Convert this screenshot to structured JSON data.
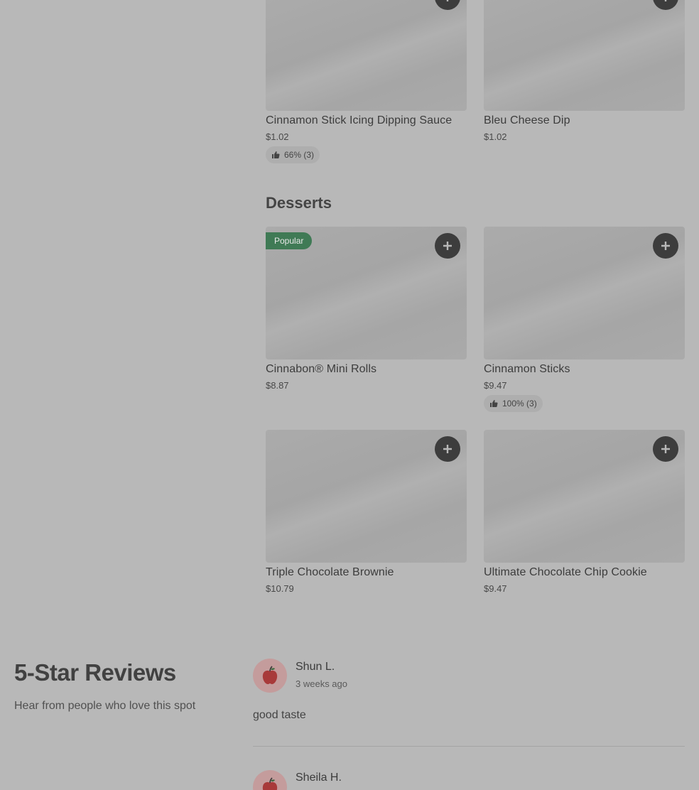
{
  "top_items": [
    {
      "name": "Cinnamon Stick Icing Dipping Sauce",
      "price": "$1.02",
      "rating": "66% (3)"
    },
    {
      "name": "Bleu Cheese Dip",
      "price": "$1.02",
      "rating": ""
    }
  ],
  "desserts": {
    "title": "Desserts",
    "items": [
      {
        "name": "Cinnabon® Mini Rolls",
        "price": "$8.87",
        "badge": "Popular",
        "rating": ""
      },
      {
        "name": "Cinnamon Sticks",
        "price": "$9.47",
        "rating": "100% (3)"
      },
      {
        "name": "Triple Chocolate Brownie",
        "price": "$10.79",
        "rating": ""
      },
      {
        "name": "Ultimate Chocolate Chip Cookie",
        "price": "$9.47",
        "rating": ""
      }
    ]
  },
  "reviews": {
    "title": "5-Star Reviews",
    "subtitle": "Hear from people who love this spot",
    "items": [
      {
        "author": "Shun L.",
        "time": "3 weeks ago",
        "text": "good taste",
        "avatar_icon": "apple-icon"
      },
      {
        "author": "Sheila H.",
        "time": "",
        "text": "",
        "avatar_icon": "apple-icon"
      }
    ]
  },
  "colors": {
    "background": "#b8b8b8",
    "badge": "#3f7a55",
    "button": "#3d3d3d"
  }
}
